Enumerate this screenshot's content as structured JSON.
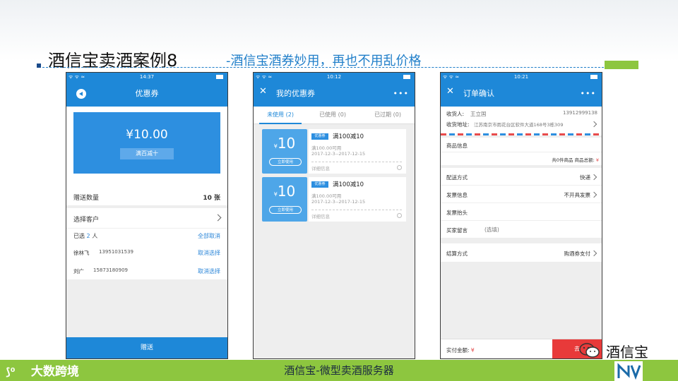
{
  "slide": {
    "title_main": "酒信宝卖酒案例8",
    "title_sub": "-酒信宝酒券妙用，再也不用乱价格",
    "footer_center": "酒信宝-微型卖酒服务器",
    "footer_logo": "大数跨境",
    "wechat_brand": "酒信宝",
    "accent_green": "#8dc63f",
    "accent_blue": "#1e88d8"
  },
  "phone1": {
    "status_left": "ᯤ  ᯤ ≈",
    "status_time": "14:37",
    "title": "优惠券",
    "coupon_amount": "¥10.00",
    "coupon_rule": "满百减十",
    "gift_qty_label": "赠送数量",
    "gift_qty_value": "10 张",
    "select_customer": "选择客户",
    "selected_prefix": "已选",
    "selected_count": "2",
    "selected_suffix": "人",
    "cancel_all": "全部取消",
    "customers": [
      {
        "name": "徐林飞",
        "phone": "13951031539",
        "action": "取消选择"
      },
      {
        "name": "刘广",
        "phone": "15873180909",
        "action": "取消选择"
      }
    ],
    "submit": "赠送"
  },
  "phone2": {
    "status_left": "ᯤ  ᯤ ≈",
    "status_time": "10:12",
    "title": "我的优惠券",
    "tabs": [
      "未使用 (2)",
      "已使用 (0)",
      "已过期 (0)"
    ],
    "coupons": [
      {
        "value": "10",
        "currency": "¥",
        "use": "立即使用",
        "tag": "优惠券",
        "name": "满100减10",
        "min": "满100.00可用",
        "date": "2017-12-3--2017-12-15",
        "detail": "详细信息"
      },
      {
        "value": "10",
        "currency": "¥",
        "use": "立即使用",
        "tag": "优惠券",
        "name": "满100减10",
        "min": "满100.00可用",
        "date": "2017-12-3--2017-12-15",
        "detail": "详细信息"
      }
    ]
  },
  "phone3": {
    "status_left": "ᯤ  ᯤ ≈",
    "status_time": "10:21",
    "title": "订单确认",
    "receiver_label": "收货人:",
    "receiver_name": "王立国",
    "receiver_phone": "13912999138",
    "address_label": "收货地址:",
    "address_value": "江苏南京市雨花台区软件大道168号3栋309",
    "goods_info": "商品信息",
    "goods_summary": "共0件商品 商品总额:",
    "goods_summary_currency": "¥",
    "delivery_label": "配送方式",
    "delivery_value": "快递",
    "invoice_label": "发票信息",
    "invoice_value": "不开具发票",
    "invoice_title_label": "发票抬头",
    "message_label": "买家留言",
    "message_placeholder": "(选填)",
    "settle_label": "结算方式",
    "settle_value": "购酒券支付",
    "actual_pay_label": "实付金额:",
    "actual_pay_currency": "¥",
    "pay_button": "去"
  }
}
